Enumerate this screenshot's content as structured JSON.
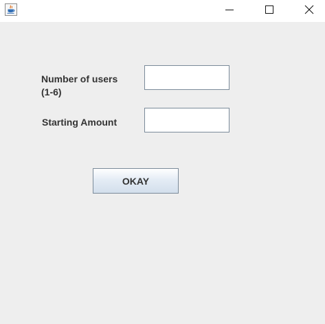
{
  "window": {
    "app_icon": "java-cup-icon",
    "controls": [
      "minimize-icon",
      "maximize-icon",
      "close-icon"
    ]
  },
  "form": {
    "users_label_line1": "Number of users",
    "users_label_line2": "(1-6)",
    "users_value": "",
    "amount_label": "Starting Amount",
    "amount_value": "",
    "okay_label": "OKAY"
  }
}
